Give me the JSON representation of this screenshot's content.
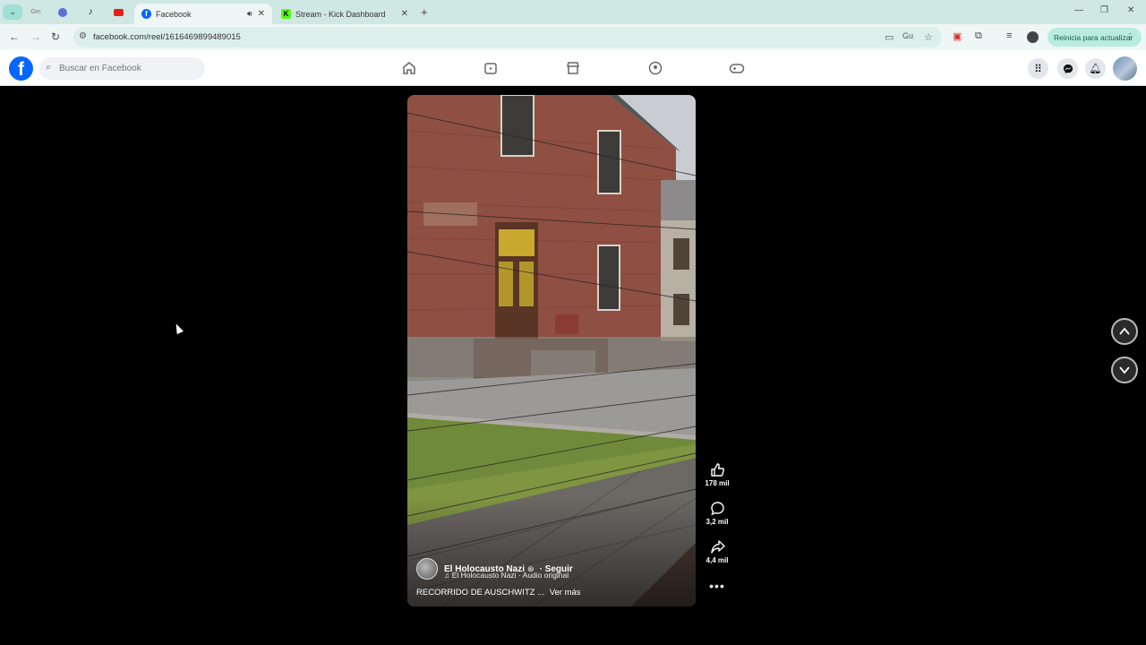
{
  "browser": {
    "tabs": [
      {
        "title": "Facebook",
        "active": true
      },
      {
        "title": "Stream - Kick Dashboard",
        "active": false
      }
    ],
    "mini_tabs": [
      "Gm"
    ],
    "url": "facebook.com/reel/1616469899489015",
    "update_label": "Reinicia para actualizar",
    "colors": {
      "chrome_bg": "#cfe8e4",
      "active_tab": "#eef7f5",
      "kick_green": "#53fc18",
      "update_bg": "#b8ecdf"
    }
  },
  "facebook": {
    "search_placeholder": "Buscar en Facebook",
    "brand_color": "#0866ff",
    "nav_icons": [
      "home-icon",
      "video-icon",
      "marketplace-icon",
      "groups-icon",
      "gaming-icon"
    ],
    "right_icons": [
      "menu-grid-icon",
      "messenger-icon",
      "notifications-icon",
      "profile-avatar"
    ]
  },
  "reel": {
    "author": "El Holocausto Nazi",
    "follow_label": "· Seguir",
    "audio": "El Holocausto Nazi · Audio original",
    "caption": "RECORRIDO DE AUSCHWITZ ...",
    "see_more": "Ver más",
    "likes": "178 mil",
    "comments": "3,2 mil",
    "shares": "4,4 mil"
  }
}
